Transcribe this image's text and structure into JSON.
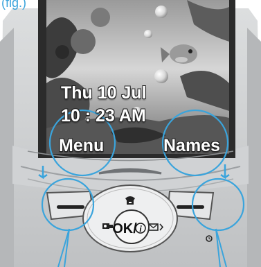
{
  "figure_label": "(fig.)",
  "screen": {
    "date": "Thu 10 Jul",
    "time": "10 : 23 AM",
    "softkey_left": "Menu",
    "softkey_right": "Names"
  },
  "keypad": {
    "ok_label": "OK/",
    "info_symbol": "i",
    "up_icon": "phone-icon",
    "left_icon": "camera-icon",
    "right_icon": "message-icon",
    "right_softkey_icon": "alarm-icon"
  },
  "colors": {
    "highlight": "#3aa4dc",
    "phone_body": "#c9cbcd"
  }
}
